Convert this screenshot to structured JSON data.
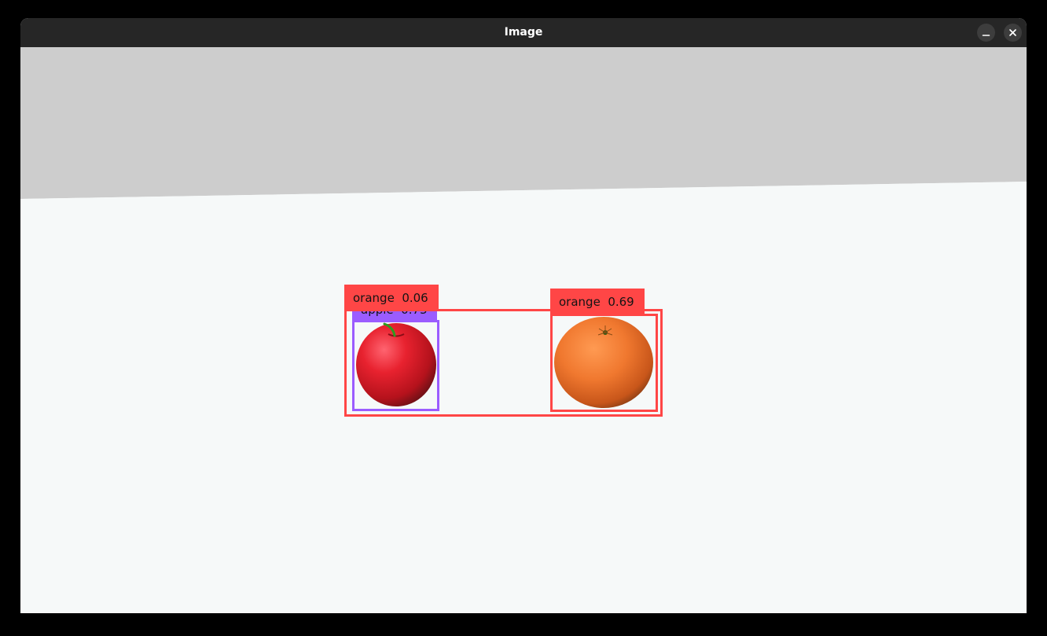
{
  "window": {
    "title": "Image",
    "minimize_icon": "minimize-icon",
    "close_icon": "close-icon"
  },
  "colors": {
    "titlebar": "#262626",
    "wall": "#cdcdcd",
    "floor": "#f6f9f9",
    "orange_class": "#ff4646",
    "apple_class": "#9b5cff"
  },
  "detections": [
    {
      "label": "orange",
      "score": "0.06",
      "text": "orange  0.06",
      "color": "#ff4646"
    },
    {
      "label": "apple",
      "score": "0.73",
      "text": "apple  0.73",
      "color": "#9b5cff"
    },
    {
      "label": "orange",
      "score": "0.69",
      "text": "orange  0.69",
      "color": "#ff4646"
    }
  ]
}
